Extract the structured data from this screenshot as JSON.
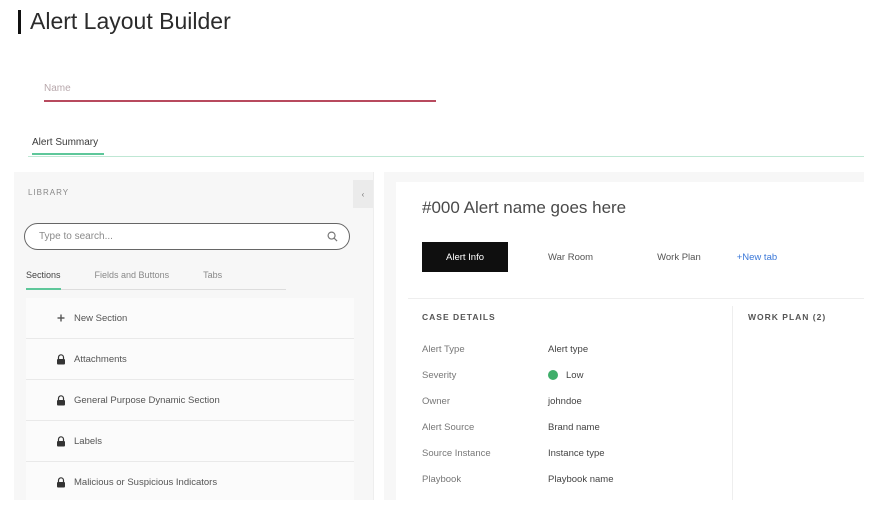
{
  "page": {
    "title": "Alert Layout Builder"
  },
  "name_field": {
    "placeholder": "Name"
  },
  "top_tab": {
    "label": "Alert Summary"
  },
  "library": {
    "label": "LIBRARY",
    "collapse_glyph": "‹",
    "search_placeholder": "Type to search...",
    "tabs": [
      {
        "label": "Sections",
        "active": true
      },
      {
        "label": "Fields and Buttons",
        "active": false
      },
      {
        "label": "Tabs",
        "active": false
      }
    ],
    "items": [
      {
        "label": "New Section",
        "icon": "plus-icon"
      },
      {
        "label": "Attachments",
        "icon": "lock-icon"
      },
      {
        "label": "General Purpose Dynamic Section",
        "icon": "lock-icon"
      },
      {
        "label": "Labels",
        "icon": "lock-icon"
      },
      {
        "label": "Malicious or Suspicious Indicators",
        "icon": "lock-icon"
      }
    ]
  },
  "alert": {
    "title": "#000  Alert name goes here",
    "tabs": [
      {
        "label": "Alert Info",
        "active": true
      },
      {
        "label": "War Room",
        "active": false
      },
      {
        "label": "Work Plan",
        "active": false
      }
    ],
    "new_tab_label": "+New tab",
    "case_details": {
      "header": "CASE DETAILS",
      "rows": [
        {
          "key": "Alert Type",
          "value": "Alert type"
        },
        {
          "key": "Severity",
          "value": "Low"
        },
        {
          "key": "Owner",
          "value": "johndoe"
        },
        {
          "key": "Alert Source",
          "value": "Brand name"
        },
        {
          "key": "Source Instance",
          "value": "Instance type"
        },
        {
          "key": "Playbook",
          "value": "Playbook name"
        }
      ]
    },
    "work_plan_header": "WORK PLAN (2)"
  },
  "colors": {
    "accent_green": "#5ec79a",
    "name_underline": "#b84a5e",
    "severity_low": "#3fae6a",
    "active_tab_bg": "#0f0f0f",
    "link_blue": "#3b78d8"
  }
}
